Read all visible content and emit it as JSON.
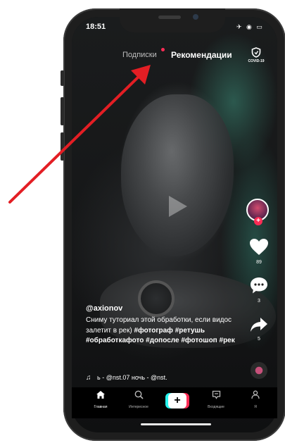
{
  "status_bar": {
    "time": "18:51",
    "icons": "✈ ◉ ▭"
  },
  "top_tabs": {
    "following": "Подписки",
    "for_you": "Рекомендации",
    "covid_label": "COVID-19"
  },
  "side_actions": {
    "likes": "89",
    "comments": "3",
    "shares": "5",
    "follow": "+"
  },
  "post": {
    "username": "@axionov",
    "caption_text": "Сниму туториал этой обработки, если видос залетит в рек)",
    "hashtags": [
      "#фотограф",
      "#ретушь",
      "#обработкафото",
      "#допосле",
      "#фотошоп",
      "#рек"
    ],
    "sound": "ь - @nst.07",
    "sound_2": "ночь - @nst."
  },
  "bottom_nav": {
    "home": "Главная",
    "discover": "Интересное",
    "create": "+",
    "inbox": "Входящие",
    "profile": "Я"
  },
  "colors": {
    "accent": "#fe2c55",
    "teal": "#25f4ee",
    "arrow": "#e31e24"
  }
}
